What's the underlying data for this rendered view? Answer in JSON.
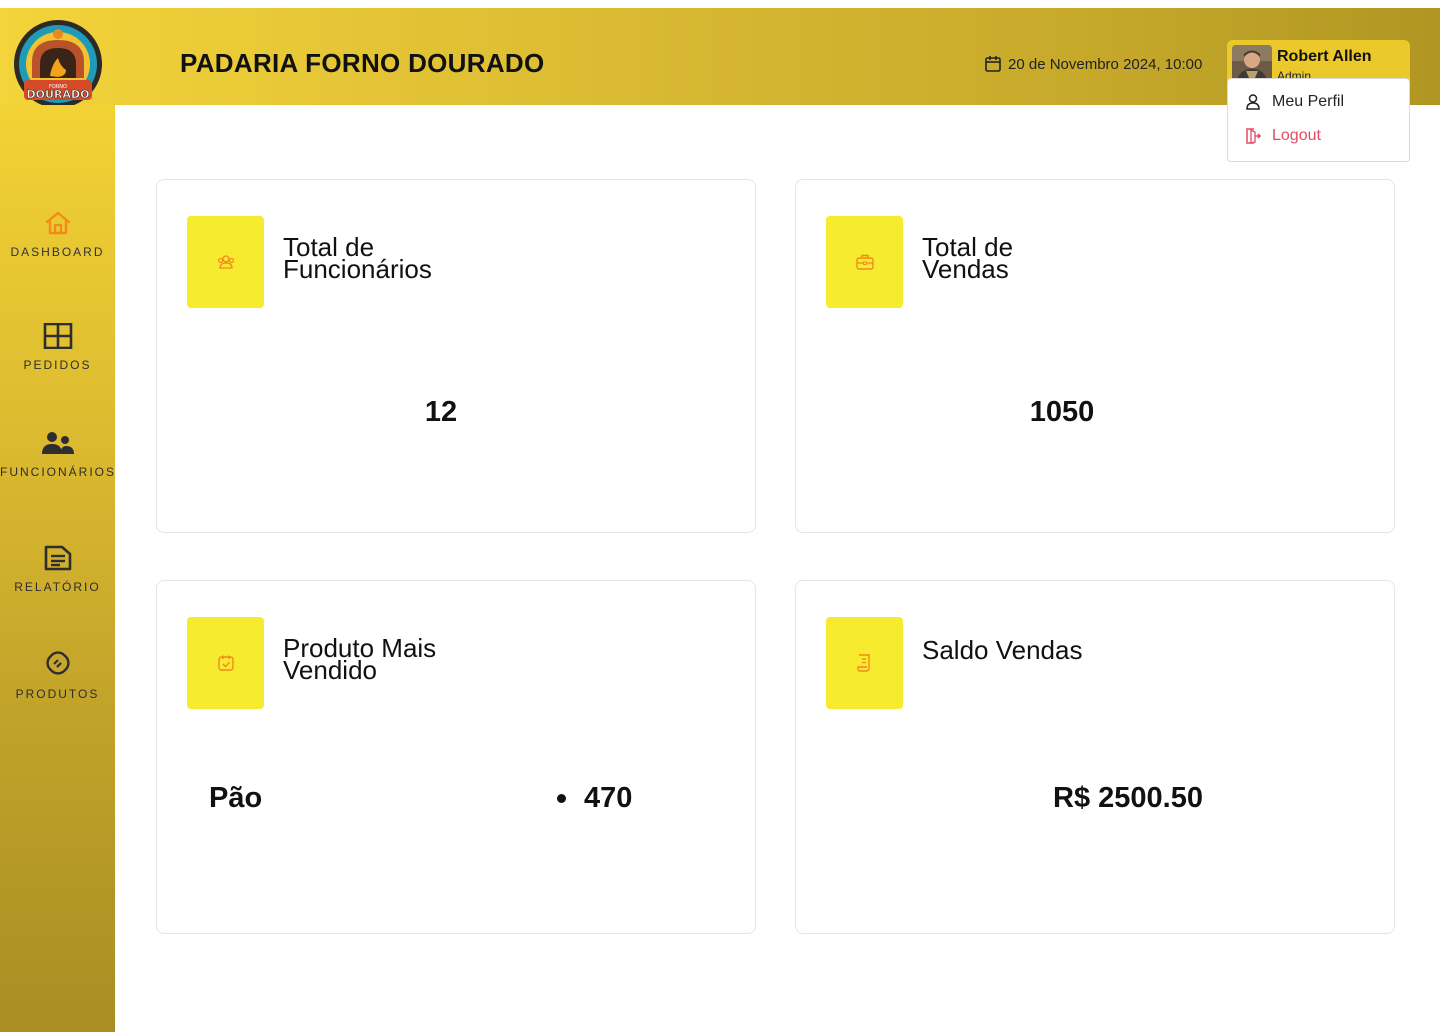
{
  "header": {
    "title": "PADARIA FORNO DOURADO",
    "datetime": "20 de Novembro 2024, 10:00",
    "logo_text_small": "FORNO",
    "logo_text": "DOURADO"
  },
  "user": {
    "name": "Robert Allen",
    "role": "Admin",
    "menu": {
      "profile_label": "Meu Perfil",
      "logout_label": "Logout"
    }
  },
  "sidebar": {
    "items": [
      {
        "label": "DASHBOARD",
        "icon": "home-icon",
        "active": true
      },
      {
        "label": "PEDIDOS",
        "icon": "grid-icon"
      },
      {
        "label": "FUNCIONÁRIOS",
        "icon": "users-icon"
      },
      {
        "label": "RELATÓRIO",
        "icon": "document-icon"
      },
      {
        "label": "PRODUTOS",
        "icon": "bread-icon"
      }
    ]
  },
  "cards": {
    "employees": {
      "title_line1": "Total de",
      "title_line2": "Funcionários",
      "value": "12",
      "icon": "people-icon"
    },
    "sales": {
      "title_line1": "Total de",
      "title_line2": "Vendas",
      "value": "1050",
      "icon": "briefcase-icon"
    },
    "top_product": {
      "title_line1": "Produto Mais",
      "title_line2": "Vendido",
      "product": "Pão",
      "quantity": "470",
      "icon": "calendar-check-icon"
    },
    "balance": {
      "title_line1": "Saldo Vendas",
      "value": "R$ 2500.50",
      "icon": "receipt-icon"
    }
  },
  "colors": {
    "accent_yellow": "#f7eb2f",
    "header_gold": "#dcbc33",
    "icon_orange": "#f28a1c",
    "logout_red": "#e24c63"
  }
}
